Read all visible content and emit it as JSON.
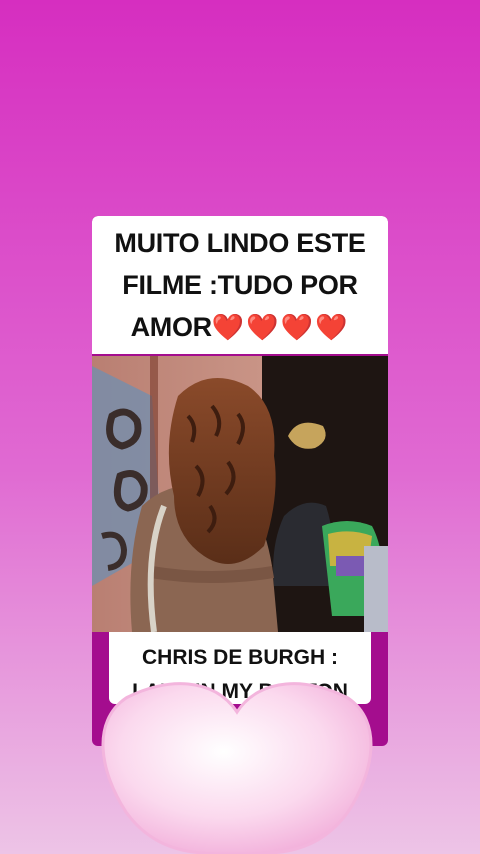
{
  "post": {
    "title": "MUITO LINDO ESTE FILME :TUDO POR AMOR",
    "title_hearts": "❤️❤️❤️❤️",
    "caption_line1": "CHRIS DE BURGH :",
    "caption_line2": "LADY IN MY BOSTON"
  },
  "colors": {
    "background_top": "#d62ec0",
    "background_bottom": "#edc4e6",
    "card_accent": "#a40d8e",
    "heart_fill": "#f7c4e4"
  },
  "icons": {
    "overlay_heart": "heart-icon",
    "title_heart": "red-heart-emoji"
  }
}
